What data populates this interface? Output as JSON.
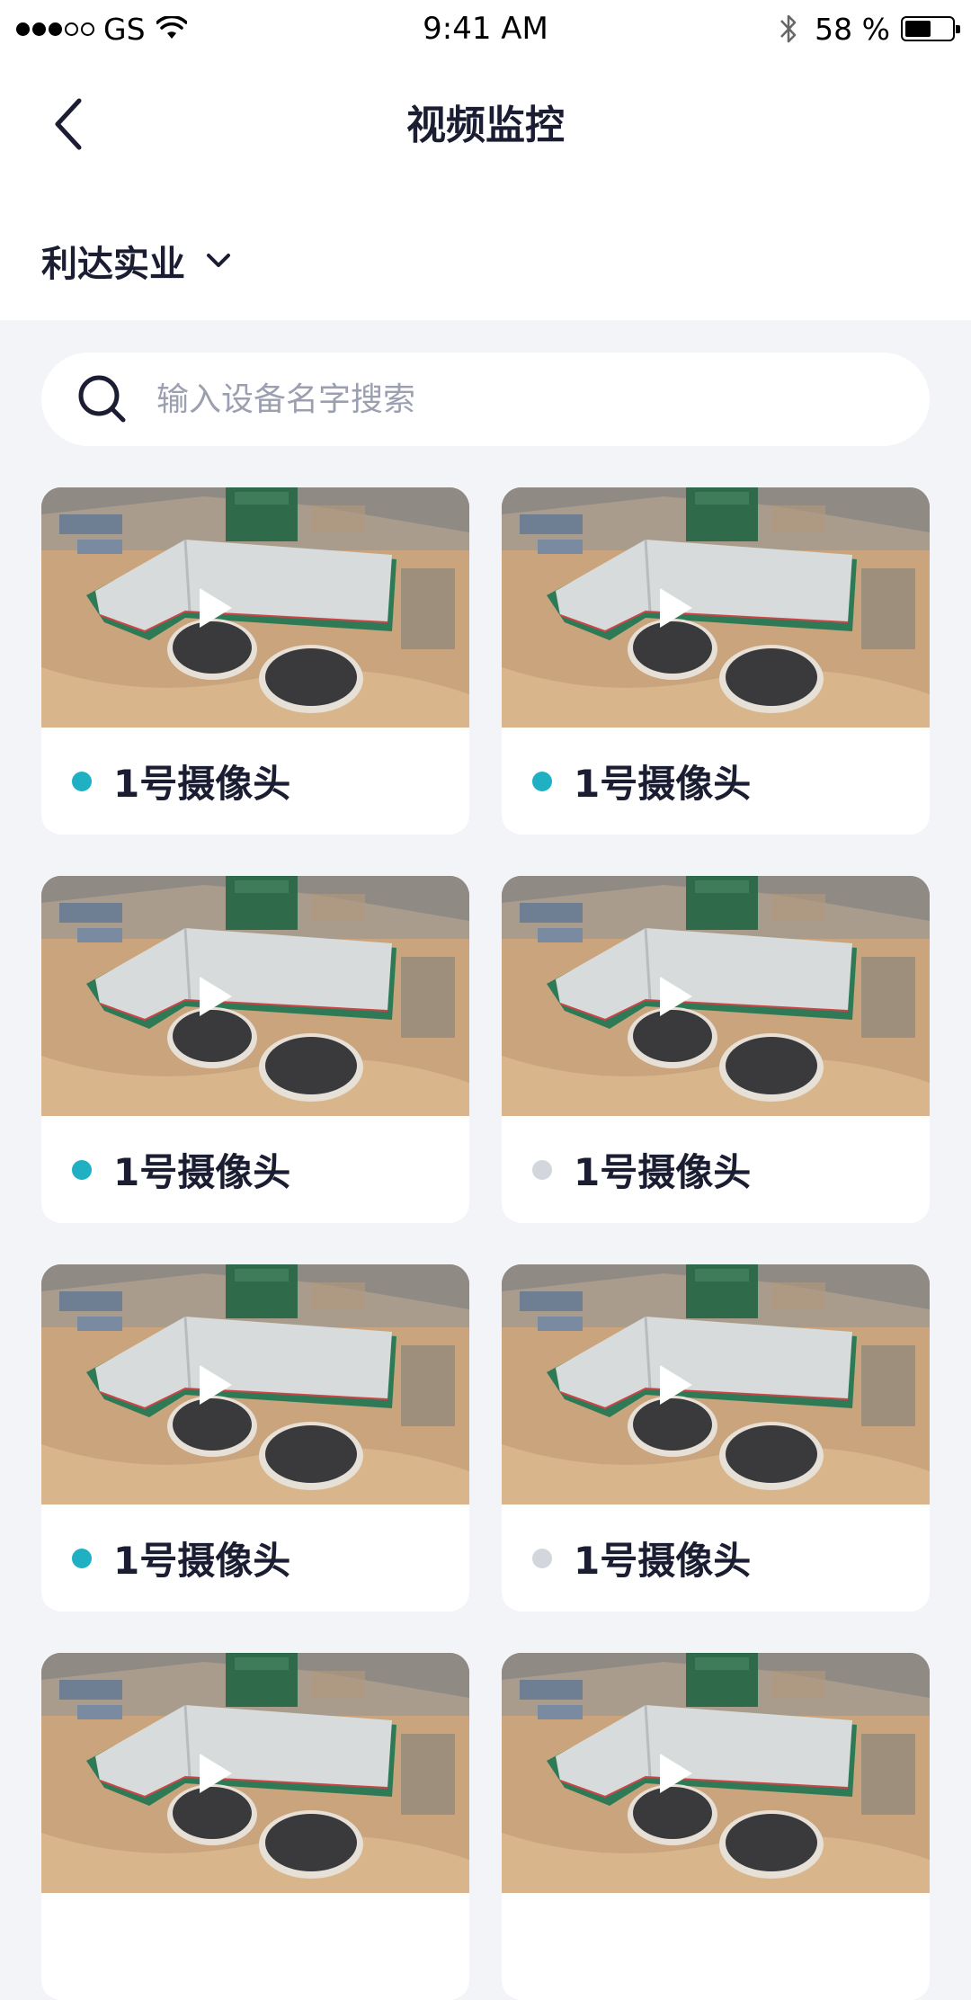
{
  "status_bar": {
    "carrier": "GS",
    "time": "9:41 AM",
    "battery": "58 %",
    "battery_level": 0.58,
    "signal_bars_filled": 3,
    "signal_bars_total": 5
  },
  "header": {
    "title": "视频监控",
    "back_icon": "chevron-left-icon"
  },
  "company": {
    "name": "利达实业",
    "dropdown_icon": "chevron-down-icon"
  },
  "search": {
    "placeholder": "输入设备名字搜索",
    "icon": "search-icon"
  },
  "colors": {
    "online": "#1fb0c4",
    "offline": "#d4d6de",
    "text": "#1b1d33",
    "background": "#f3f4f8"
  },
  "cameras": [
    {
      "name": "1号摄像头",
      "status": "online"
    },
    {
      "name": "1号摄像头",
      "status": "online"
    },
    {
      "name": "1号摄像头",
      "status": "online"
    },
    {
      "name": "1号摄像头",
      "status": "offline"
    },
    {
      "name": "1号摄像头",
      "status": "online"
    },
    {
      "name": "1号摄像头",
      "status": "offline"
    },
    {
      "name": "",
      "status": ""
    },
    {
      "name": "",
      "status": ""
    }
  ]
}
